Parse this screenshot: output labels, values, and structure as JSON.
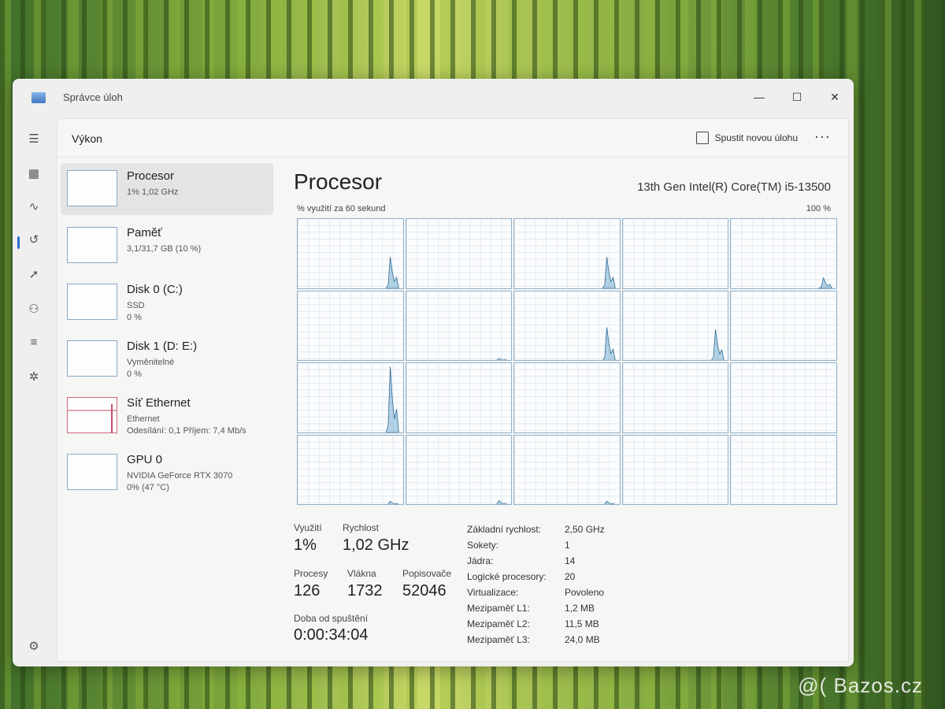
{
  "app": {
    "title": "Správce úloh"
  },
  "window_controls": {
    "minimize": "—",
    "maximize": "☐",
    "close": "✕"
  },
  "nav_icons": [
    "menu-icon",
    "processes-icon",
    "performance-icon",
    "history-icon",
    "startup-icon",
    "users-icon",
    "details-icon",
    "services-icon",
    "settings-icon"
  ],
  "header": {
    "page_title": "Výkon",
    "run_task_label": "Spustit novou úlohu",
    "more_label": "···"
  },
  "resources": [
    {
      "name": "Procesor",
      "sub1": "1% 1,02 GHz",
      "sub2": ""
    },
    {
      "name": "Paměť",
      "sub1": "3,1/31,7 GB (10 %)",
      "sub2": ""
    },
    {
      "name": "Disk 0 (C:)",
      "sub1": "SSD",
      "sub2": "0 %"
    },
    {
      "name": "Disk 1 (D: E:)",
      "sub1": "Vyměnitelné",
      "sub2": "0 %"
    },
    {
      "name": "Síť Ethernet",
      "sub1": "Ethernet",
      "sub2": "Odesílání: 0,1 Příjem: 7,4 Mb/s"
    },
    {
      "name": "GPU 0",
      "sub1": "NVIDIA GeForce RTX 3070",
      "sub2": "0% (47 °C)"
    }
  ],
  "cpu": {
    "title": "Procesor",
    "model": "13th Gen Intel(R) Core(TM) i5-13500",
    "util_label": "% využití za 60 sekund",
    "util_max": "100 %",
    "stats": {
      "util_label": "Využití",
      "util_value": "1%",
      "speed_label": "Rychlost",
      "speed_value": "1,02 GHz",
      "proc_label": "Procesy",
      "proc_value": "126",
      "threads_label": "Vlákna",
      "threads_value": "1732",
      "handles_label": "Popisovače",
      "handles_value": "52046",
      "uptime_label": "Doba od spuštění",
      "uptime_value": "0:00:34:04"
    },
    "specs": [
      {
        "key": "Základní rychlost:",
        "value": "2,50 GHz"
      },
      {
        "key": "Sokety:",
        "value": "1"
      },
      {
        "key": "Jádra:",
        "value": "14"
      },
      {
        "key": "Logické procesory:",
        "value": "20"
      },
      {
        "key": "Virtualizace:",
        "value": "Povoleno"
      },
      {
        "key": "Mezipaměť L1:",
        "value": "1,2 MB"
      },
      {
        "key": "Mezipaměť L2:",
        "value": "11,5 MB"
      },
      {
        "key": "Mezipaměť L3:",
        "value": "24,0 MB"
      }
    ],
    "core_peaks": [
      45,
      0,
      45,
      0,
      15,
      0,
      3,
      48,
      45,
      0,
      95,
      0,
      0,
      0,
      0,
      5,
      6,
      5,
      0,
      0
    ]
  },
  "wallpaper_label": "@( Bazos.cz"
}
